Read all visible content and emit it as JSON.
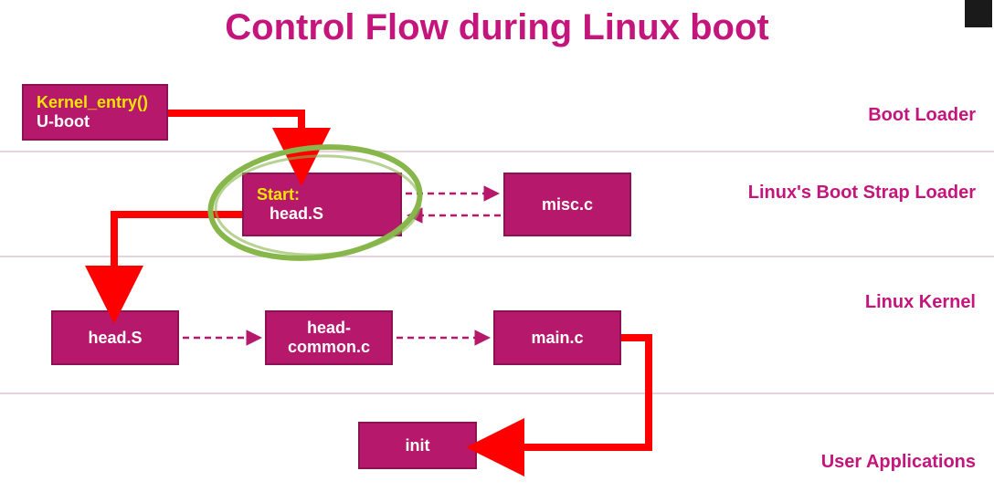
{
  "title": "Control Flow during Linux boot",
  "sections": {
    "s1": "Boot Loader",
    "s2": "Linux's Boot Strap Loader",
    "s3": "Linux Kernel",
    "s4": "User Applications"
  },
  "boxes": {
    "uboot": {
      "line1": "Kernel_entry()",
      "line2": "U-boot"
    },
    "headS_bsl": {
      "line1": "Start:",
      "line2": "head.S"
    },
    "misc": "misc.c",
    "headS_kernel": "head.S",
    "headcommon": {
      "line1": "head-",
      "line2": "common.c"
    },
    "main": "main.c",
    "init": "init"
  }
}
